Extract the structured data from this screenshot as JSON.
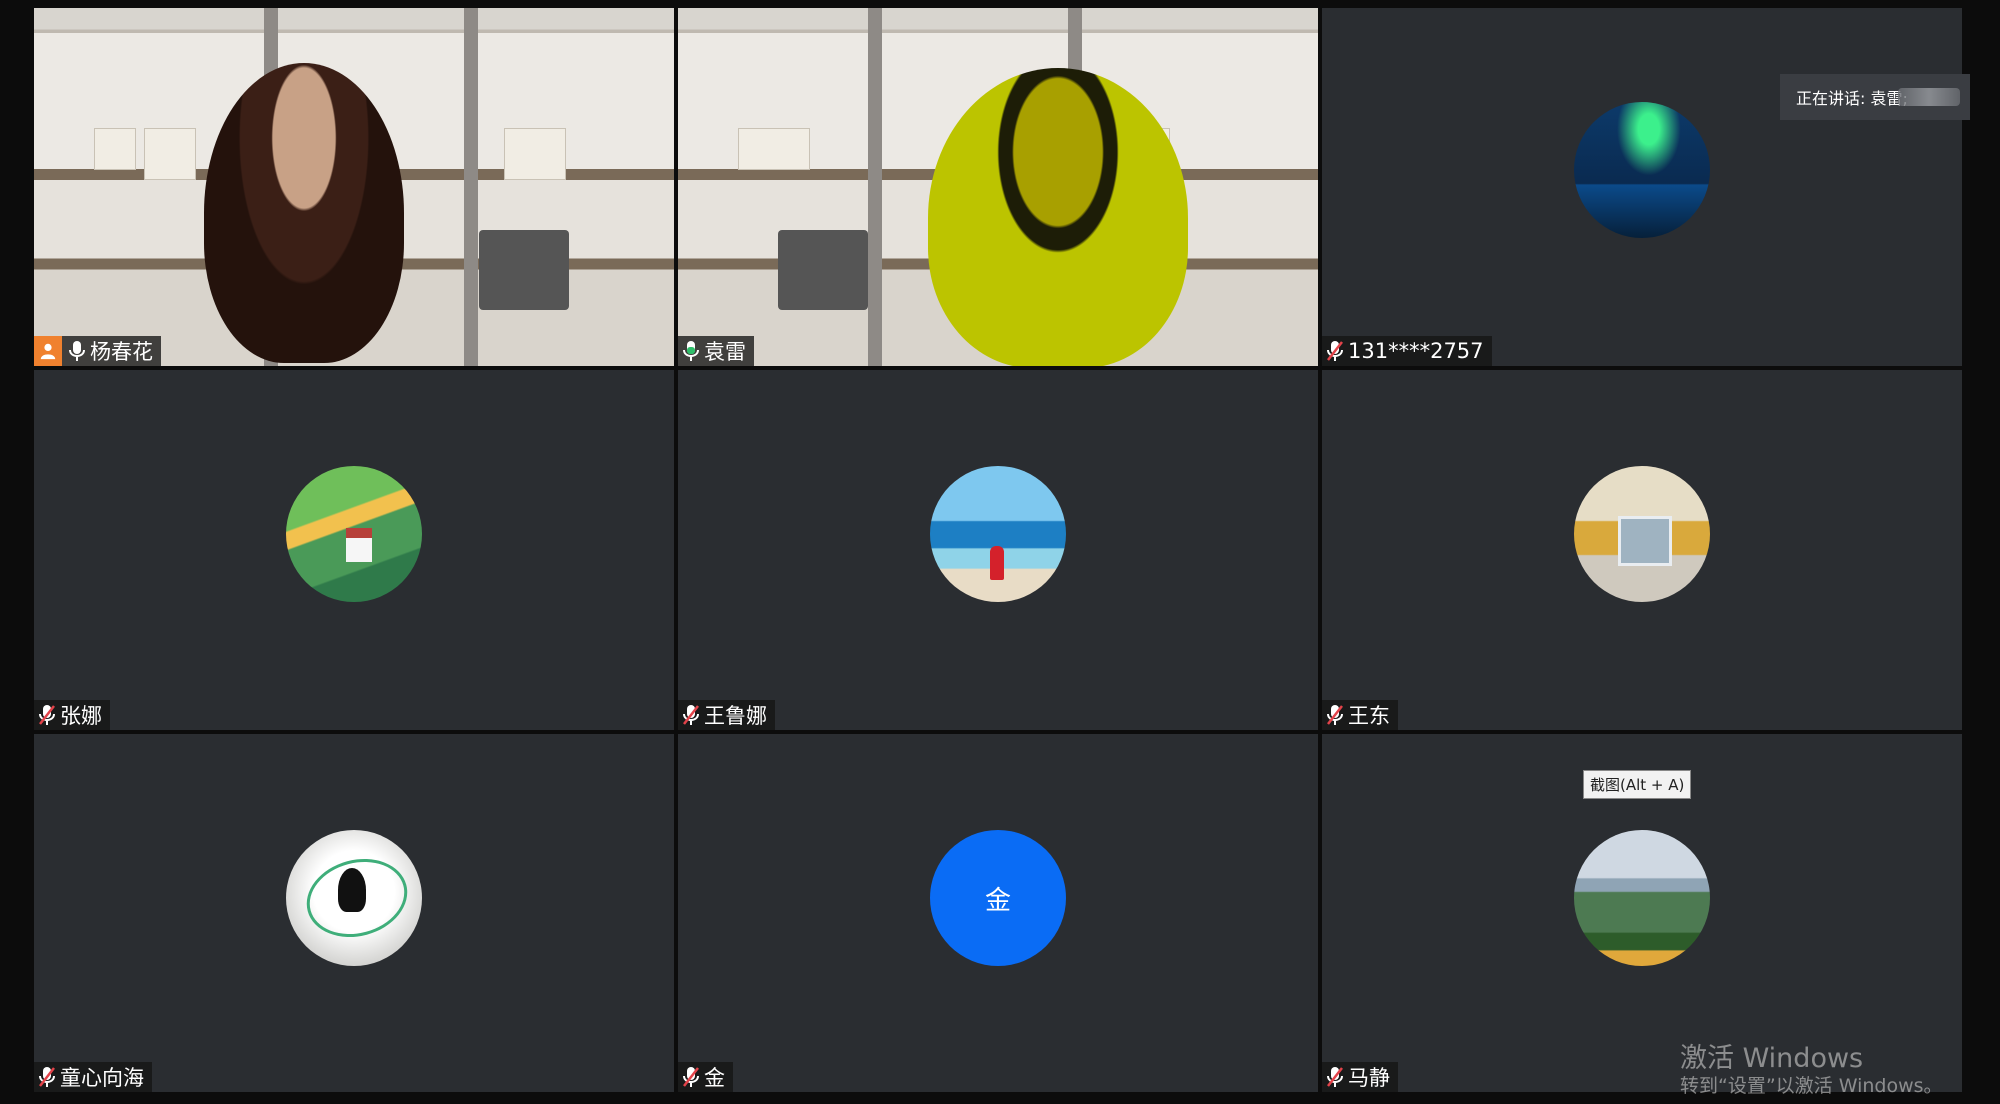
{
  "speaking": {
    "label": "正在讲话: 袁雷;"
  },
  "participants": [
    {
      "name": "杨春花",
      "video": true,
      "host": true,
      "mic": "on"
    },
    {
      "name": "袁雷",
      "video": true,
      "host": false,
      "mic": "active",
      "speaking": true
    },
    {
      "name": "131****2757",
      "video": false,
      "avatar": "aurora-photo",
      "mic": "muted"
    },
    {
      "name": "张娜",
      "video": false,
      "avatar": "farm-painting",
      "mic": "muted"
    },
    {
      "name": "王鲁娜",
      "video": false,
      "avatar": "beach-photo",
      "mic": "muted"
    },
    {
      "name": "王东",
      "video": false,
      "avatar": "building-photo",
      "mic": "muted"
    },
    {
      "name": "童心向海",
      "video": false,
      "avatar": "drawing",
      "mic": "muted"
    },
    {
      "name": "金",
      "video": false,
      "avatar_letter": "金",
      "avatar_color": "#0a6cf5",
      "mic": "muted"
    },
    {
      "name": "马静",
      "video": false,
      "avatar": "landscape-photo",
      "mic": "muted"
    }
  ],
  "tooltip": {
    "text": "截图(Alt + A)"
  },
  "watermark": {
    "line1": "激活 Windows",
    "line2": "转到“设置”以激活 Windows。"
  },
  "colors": {
    "tile_bg": "#2a2d31",
    "active_border": "#2fbf6a",
    "host_badge": "#f0812e",
    "muted_mic": "#e3434a",
    "active_mic": "#2fbf6a"
  }
}
